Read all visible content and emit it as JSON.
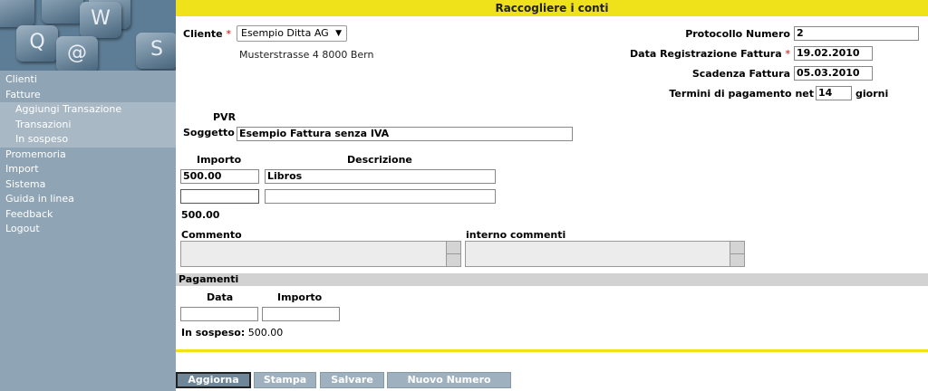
{
  "sidebar": {
    "logo_keys": [
      "Q",
      "W",
      "@",
      "S"
    ],
    "items": [
      {
        "label": "Clienti"
      },
      {
        "label": "Fatture"
      },
      {
        "label": "Aggiungi Transazione"
      },
      {
        "label": "Transazioni"
      },
      {
        "label": "In sospeso"
      },
      {
        "label": "Promemoria"
      },
      {
        "label": "Import"
      },
      {
        "label": "Sistema"
      },
      {
        "label": "Guida in linea"
      },
      {
        "label": "Feedback"
      },
      {
        "label": "Logout"
      }
    ]
  },
  "header": {
    "title": "Raccogliere i conti"
  },
  "form": {
    "cliente_label": "Cliente",
    "cliente_value": "Esempio Ditta AG",
    "address": "Musterstrasse 4 8000 Bern",
    "protocollo_label": "Protocollo Numero",
    "protocollo_value": "2",
    "data_reg_label": "Data Registrazione Fattura",
    "data_reg_value": "19.02.2010",
    "scadenza_label": "Scadenza Fattura",
    "scadenza_value": "05.03.2010",
    "termini_label": "Termini di pagamento net",
    "termini_value": "14",
    "giorni_label": "giorni",
    "pvr_label": "PVR",
    "soggetto_label": "Soggetto",
    "soggetto_value": "Esempio Fattura senza IVA",
    "importo_header": "Importo",
    "descrizione_header": "Descrizione",
    "line_items": [
      {
        "importo": "500.00",
        "descrizione": "Libros"
      },
      {
        "importo": "",
        "descrizione": ""
      }
    ],
    "total": "500.00",
    "commento_label": "Commento",
    "interno_label": "interno commenti",
    "required_marker": "*"
  },
  "payments": {
    "header": "Pagamenti",
    "data_header": "Data",
    "importo_header": "Importo",
    "data_value": "",
    "importo_value": "",
    "outstanding_label": "In sospeso:",
    "outstanding_value": "500.00"
  },
  "buttons": {
    "aggiorna": "Aggiorna",
    "stampa": "Stampa",
    "salvare": "Salvare",
    "nuovo": "Nuovo Numero"
  },
  "colors": {
    "accent_yellow": "#f0e21a",
    "sidebar_bg": "#8fa4b4",
    "button_bg": "#9fb0bf",
    "required_red": "#cc0000"
  }
}
